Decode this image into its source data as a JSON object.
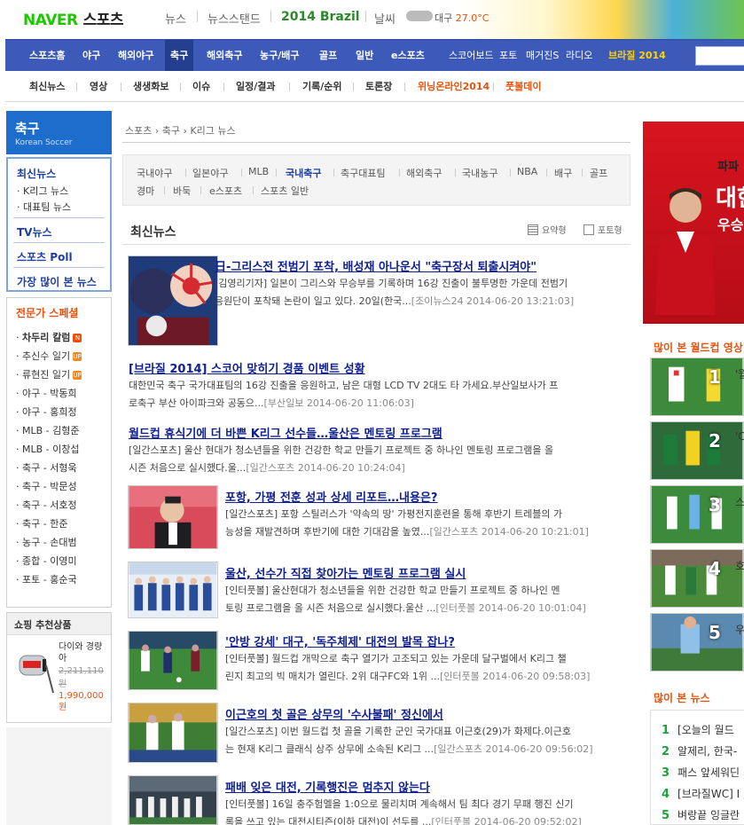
{
  "header": {
    "logo_naver": "NAVER",
    "logo_sports": "스포츠",
    "links": [
      "뉴스",
      "뉴스스탠드"
    ],
    "brazil": "2014 Brazil",
    "weather_label": "날씨",
    "weather_city": "대구",
    "weather_temp": "27.0°C"
  },
  "gnb": {
    "items": [
      "스포츠홈",
      "야구",
      "해외야구",
      "축구",
      "해외축구",
      "농구/배구",
      "골프",
      "일반",
      "e스포츠"
    ],
    "extra": [
      "스코어보드",
      "포토",
      "매거진S",
      "라디오"
    ],
    "special": "브라질 2014"
  },
  "lnb": {
    "items": [
      "최신뉴스",
      "영상",
      "생생화보",
      "이슈",
      "일정/결과",
      "기록/순위",
      "토론장"
    ],
    "red": [
      "위닝온라인2014",
      "풋볼데이"
    ]
  },
  "left": {
    "title": "축구",
    "subtitle": "Korean Soccer",
    "news_head": "최신뉴스",
    "news_subs": [
      "K리그 뉴스",
      "대표팀 뉴스"
    ],
    "menu": [
      "TV뉴스",
      "스포츠 Poll",
      "가장 많이 본 뉴스"
    ],
    "expert_head": "전문가 스페셜",
    "experts": [
      "차두리 칼럼",
      "추신수 일기",
      "류현진 일기",
      "야구 - 박동희",
      "야구 - 홍희정",
      "MLB - 김형준",
      "MLB - 이창섭",
      "축구 - 서형욱",
      "축구 - 박문성",
      "축구 - 서호정",
      "축구 - 한준",
      "농구 - 손대범",
      "종합 - 이영미",
      "포토 - 홍순국"
    ],
    "badge_n": "N",
    "badge_up": "UP",
    "shop_head": "쇼핑 추천상품",
    "shop_name": "다이와 경량 아",
    "shop_old": "2,211,110원",
    "shop_new": "1,990,000원"
  },
  "main": {
    "crumbs": [
      "스포츠",
      "축구",
      "K리그 뉴스"
    ],
    "cats_row1": [
      "국내야구",
      "일본야구",
      "MLB",
      "국내축구",
      "축구대표팀",
      "해외축구",
      "국내농구",
      "NBA",
      "배구",
      "골프"
    ],
    "cats_row2": [
      "경마",
      "바둑",
      "e스포츠",
      "스포츠 일반"
    ],
    "list_title": "최신뉴스",
    "view_summary": "요약형",
    "view_photo": "포토형",
    "articles": [
      {
        "title": "日-그리스전 전범기 포착, 배성재 아나운서 \"축구장서 퇴출시켜야\"",
        "l1": "[김영리기자] 일본이 그리스와 무승부를 기록하며 16강 진출이 불투명한 가운데 전범기",
        "l2": "응원단이 포착돼 논란이 일고 있다. 20일(한국...",
        "meta": "[조이뉴스24 2014-06-20 13:21:03]"
      },
      {
        "title": "[브라질 2014] 스코어 맞히기 경품 이벤트 성황",
        "l1": "대한민국 축구 국가대표팀의 16강 진출을 응원하고, 남은 대형 LCD TV 2대도 타 가세요.부산일보사가 프",
        "l2": "로축구 부산 아이파크와 공동으...",
        "meta": "[부산일보 2014-06-20 11:06:03]"
      },
      {
        "title": "월드컵 휴식기에 더 바쁜 K리그 선수들…울산은 멘토링 프로그램",
        "l1": "[일간스포츠] 울산 현대가 청소년들을 위한 건강한 학교 만들기 프로젝트 중 하나인 멘토링 프로그램을 올",
        "l2": "시즌 처음으로 실시했다.울...",
        "meta": "[일간스포츠 2014-06-20 10:24:04]"
      },
      {
        "title": "포항, 가평 전훈 성과 상세 리포트…내용은?",
        "l1": "[일간스포츠] 포항 스틸러스가 '약속의 땅' 가평전지훈련을 통해 후반기 트레블의 가",
        "l2": "능성을 재발견하며 후반기에 대한 기대감을 높였...",
        "meta": "[일간스포츠 2014-06-20 10:21:01]"
      },
      {
        "title": "울산, 선수가 직접 찾아가는 멘토링 프로그램 실시",
        "l1": "[인터풋볼] 울산현대가 청소년들을 위한 건강한 학교 만들기 프로젝트 중 하나인 멘",
        "l2": "토링 프로그램을 올 시즌 처음으로 실시했다.울산 ...",
        "meta": "[인터풋볼 2014-06-20 10:01:04]"
      },
      {
        "title": "'안방 강세' 대구, '독주체제' 대전의 발목 잡나?",
        "l1": "[인터풋볼] 월드컵 개막으로 축구 열기가 고조되고 있는 가운데 달구벌에서 K리그 챌",
        "l2": "린지 최고의 빅 매치가 열린다. 2위 대구FC와 1위 ...",
        "meta": "[인터풋볼 2014-06-20 09:58:03]"
      },
      {
        "title": "이근호의 첫 골은 상무의 '수사불패' 정신에서",
        "l1": "[일간스포츠] 이번 월드컵 첫 골을 기록한 군인 국가대표 이근호(29)가 화제다.이근호",
        "l2": "는 현재 K리그 클래식 상주 상무에 소속된 K리그 ...",
        "meta": "[일간스포츠 2014-06-20 09:56:02]"
      },
      {
        "title": "패배 잊은 대전, 기록행진은 멈추지 않는다",
        "l1": "[인터풋볼] 16일 충주험멜을 1:0으로 물리치며 계속해서 팀 최다 경기 무패 행진 신기",
        "l2": "록을 쓰고 있는 대전시티즌(이하 대전)이 선두를 ...",
        "meta": "[인터풋볼 2014-06-20 09:52:02]"
      }
    ]
  },
  "right": {
    "banner_t1": "파파",
    "banner_t2": "대한민",
    "banner_t3": "우승 기",
    "video_head": "많이 본 월드컵 영상",
    "videos": [
      {
        "n": "1",
        "t": "'월"
      },
      {
        "n": "2",
        "t": "'C"
      },
      {
        "n": "3",
        "t": "스"
      },
      {
        "n": "4",
        "t": "호"
      },
      {
        "n": "5",
        "t": "우"
      }
    ],
    "news_head": "많이 본 뉴스",
    "news": [
      {
        "n": "1",
        "t": "[오늘의 월드"
      },
      {
        "n": "2",
        "t": "알제리, 한국-"
      },
      {
        "n": "3",
        "t": "패스 앞세워딘"
      },
      {
        "n": "4",
        "t": "[브라질WC] I"
      },
      {
        "n": "5",
        "t": "벼랑끝 잉글란"
      }
    ]
  }
}
